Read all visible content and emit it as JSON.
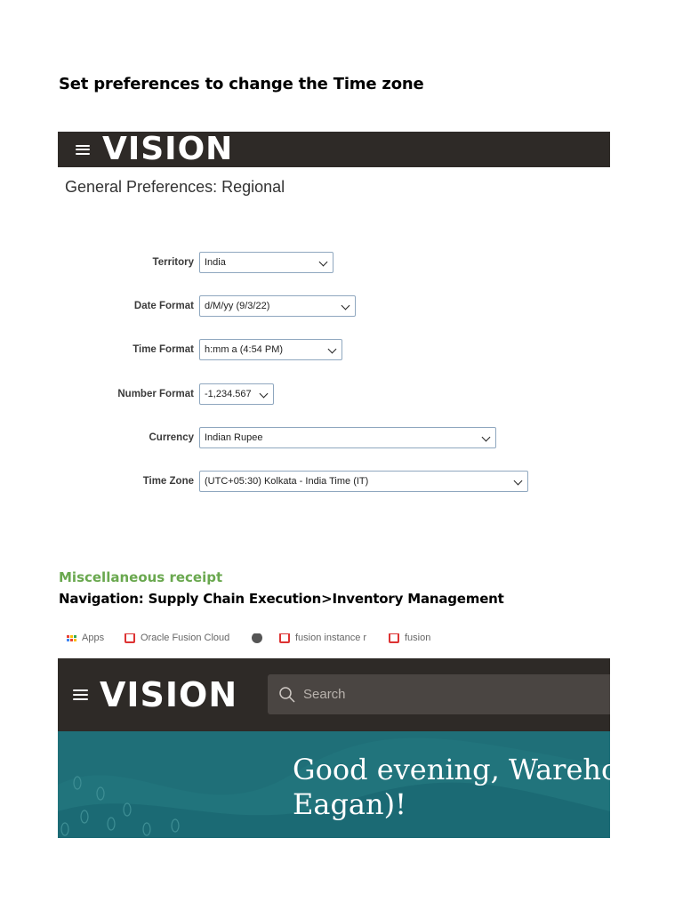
{
  "doc": {
    "heading": "Set preferences to change the Time zone",
    "misc_heading": "Miscellaneous receipt",
    "navigation": "Navigation: Supply Chain Execution>Inventory Management"
  },
  "brand": {
    "logo_text": "VISION",
    "bar_color": "#2e2a27",
    "banner_color": "#1f6f78",
    "accent_green": "#6aa84f"
  },
  "preferences": {
    "title": "General Preferences: Regional",
    "fields": [
      {
        "label": "Territory",
        "value": "India"
      },
      {
        "label": "Date Format",
        "value": "d/M/yy (9/3/22)"
      },
      {
        "label": "Time Format",
        "value": "h:mm a (4:54 PM)"
      },
      {
        "label": "Number Format",
        "value": "-1,234.567"
      },
      {
        "label": "Currency",
        "value": "Indian Rupee"
      },
      {
        "label": "Time Zone",
        "value": "(UTC+05:30) Kolkata - India Time (IT)"
      }
    ]
  },
  "bookmarks": [
    {
      "label": "Apps",
      "icon": "apps-grid-icon"
    },
    {
      "label": "Oracle Fusion Cloud",
      "icon": "oracle-icon"
    },
    {
      "label": "",
      "icon": "globe-icon"
    },
    {
      "label": "fusion instance r",
      "icon": "oracle-icon"
    },
    {
      "label": "fusion",
      "icon": "oracle-icon"
    }
  ],
  "home": {
    "search_placeholder": "Search",
    "greeting_line1": "Good evening, Warehou",
    "greeting_line2": "Eagan)!"
  }
}
